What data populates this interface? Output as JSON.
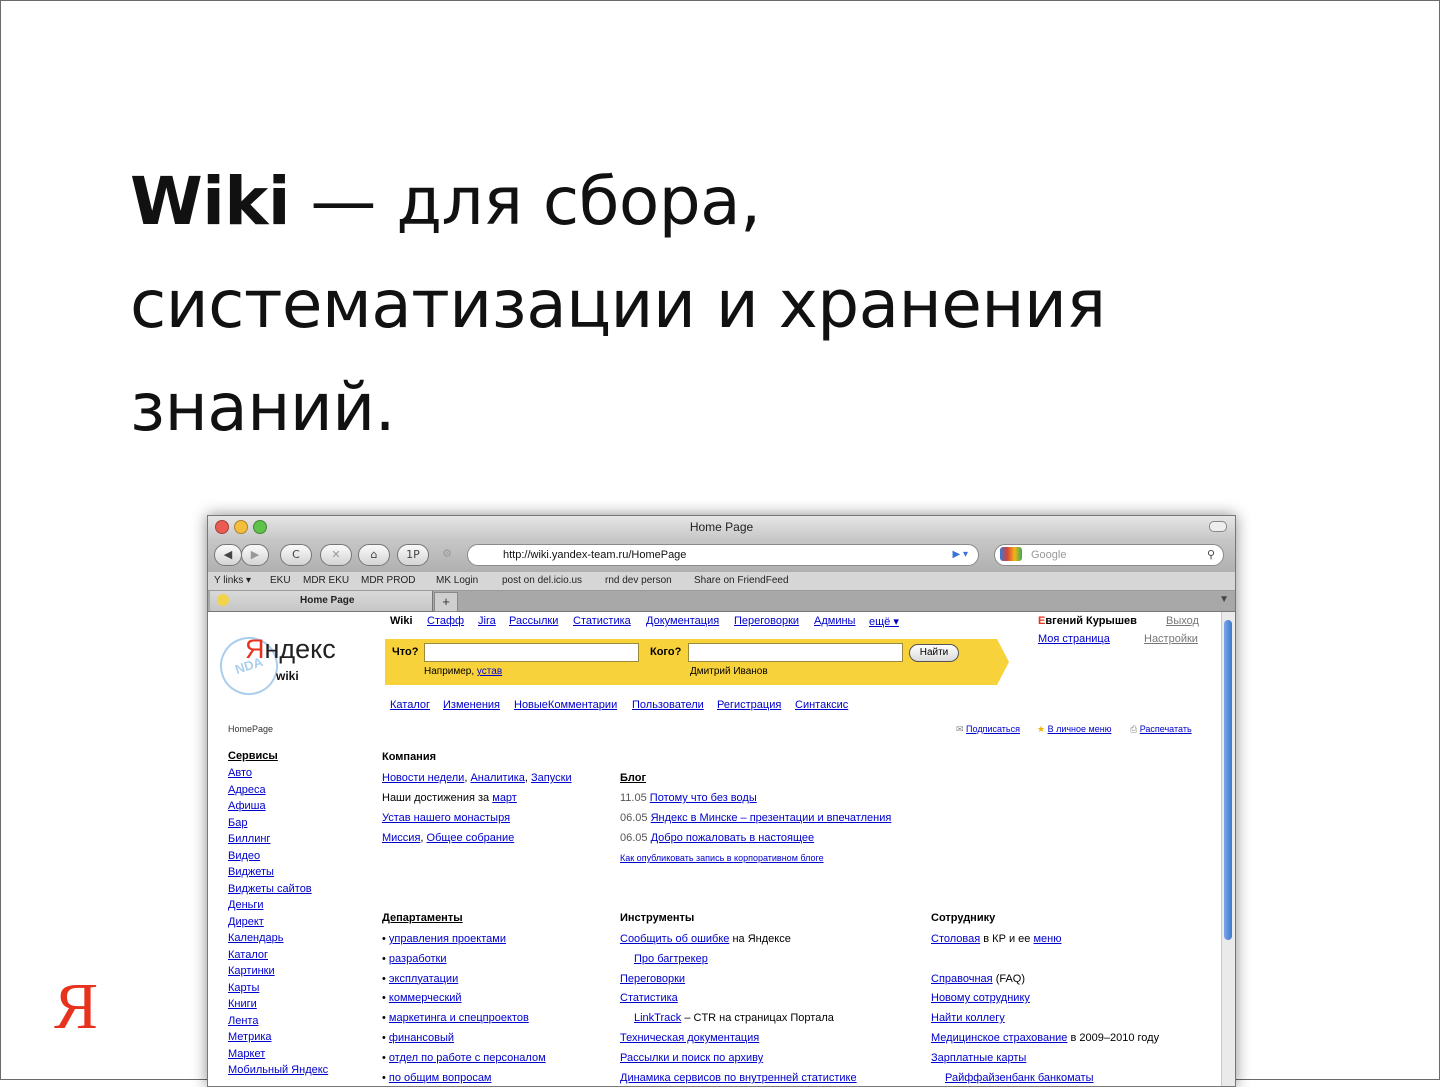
{
  "slide": {
    "title_bold": "Wiki",
    "title_rest": " — для сбора, систематизации и хранения знаний.",
    "logo": "Я"
  },
  "browser": {
    "window_title": "Home Page",
    "url": "http://wiki.yandex-team.ru/HomePage",
    "search_placeholder": "Google",
    "bookmarks": [
      "Y links ▾",
      "EKU",
      "MDR EKU",
      "MDR PROD",
      "MK Login",
      "post on del.icio.us",
      "rnd dev person",
      "Share on FriendFeed"
    ],
    "tab_label": "Home Page",
    "new_tab": "+",
    "buttons": {
      "back": "◀",
      "forward": "▶",
      "reload": "C",
      "stop": "✕",
      "home": "⌂",
      "onep": "1P",
      "gear": "⚙"
    }
  },
  "page": {
    "logo_brand": "ндекс",
    "logo_brand_first": "Я",
    "logo_sub": "wiki",
    "stamp": "NDA",
    "breadcrumb": "HomePage",
    "topnav": [
      "Wiki",
      "Стафф",
      "Jira",
      "Рассылки",
      "Статистика",
      "Документация",
      "Переговорки",
      "Админы",
      "ещё ▾"
    ],
    "search": {
      "what_label": "Что?",
      "who_label": "Кого?",
      "find_button": "Найти",
      "example_prefix": "Например,",
      "example_link": "устав",
      "who_example": "Дмитрий Иванов"
    },
    "subnav": [
      "Каталог",
      "Изменения",
      "НовыеКомментарии",
      "Пользователи",
      "Регистрация",
      "Синтаксис"
    ],
    "user": {
      "name_first": "Е",
      "name_rest": "вгений Курышев",
      "logout": "Выход",
      "my_page": "Моя страница",
      "settings": "Настройки"
    },
    "actions": {
      "subscribe": "Подписаться",
      "personal_menu": "В личное меню",
      "print": "Распечатать"
    },
    "services_title": "Сервисы",
    "services": [
      "Авто",
      "Адреса",
      "Афиша",
      "Бар",
      "Биллинг",
      "Видео",
      "Виджеты",
      "Виджеты сайтов",
      "Деньги",
      "Директ",
      "Календарь",
      "Каталог",
      "Картинки",
      "Карты",
      "Книги",
      "Лента",
      "Метрика",
      "Маркет",
      "Мобильный Яндекс"
    ],
    "company": {
      "title": "Компания",
      "l1a": "Новости недели",
      "l1b": "Аналитика",
      "l1c": "Запуски",
      "l2_text": "Наши достижения за",
      "l2_link": "март",
      "l3": "Устав нашего монастыря",
      "l4a": "Миссия",
      "l4b": "Общее собрание"
    },
    "blog": {
      "title": "Блог",
      "posts": [
        {
          "date": "11.05",
          "title": "Потому что без воды"
        },
        {
          "date": "06.05",
          "title": "Яндекс в Минске – презентации и впечатления"
        },
        {
          "date": "06.05",
          "title": "Добро пожаловать в настоящее"
        }
      ],
      "howto": "Как опубликовать запись в корпоративном блоге"
    },
    "departments": {
      "title": "Департаменты",
      "items": [
        "управления проектами",
        "разработки",
        "эксплуатации",
        "коммерческий",
        "маркетинга и спецпроектов",
        "финансовый",
        "отдел по работе с персоналом",
        "по общим вопросам"
      ]
    },
    "tools": {
      "title": "Инструменты",
      "r1_link": "Сообщить об ошибке",
      "r1_text": "на Яндексе",
      "r2": "Про багтрекер",
      "r3": "Переговорки",
      "r4": "Статистика",
      "r5_link": "LinkTrack",
      "r5_text": "– CTR на страницах Портала",
      "r6": "Техническая документация",
      "r7": "Рассылки и поиск по архиву",
      "r8": "Динамика сервисов по внутренней статистике"
    },
    "employee": {
      "title": "Сотруднику",
      "r1_link": "Столовая",
      "r1_text": "в КР и ее",
      "r1_link2": "меню",
      "r2_link": "Справочная",
      "r2_text": "(FAQ)",
      "r3": "Новому сотруднику",
      "r4": "Найти коллегу",
      "r5_link": "Медицинское страхование",
      "r5_text": "в 2009–2010 году",
      "r6": "Зарплатные карты",
      "r7": "Райффайзенбанк банкоматы"
    }
  },
  "colors": {
    "yandex_red": "#e8321e",
    "search_yellow": "#f8d23a",
    "link_blue": "#0000cc"
  }
}
